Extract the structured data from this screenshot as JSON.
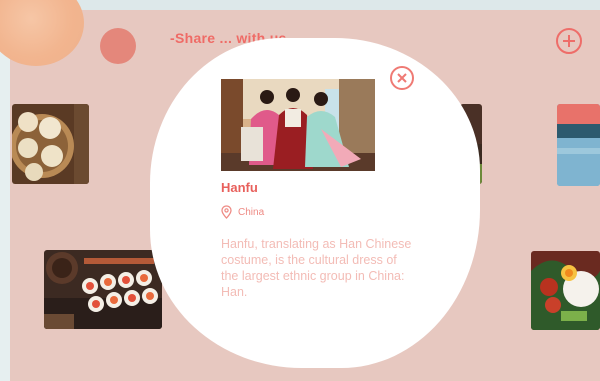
{
  "header": {
    "title": "-Share ... with us-",
    "add_icon": "plus-circle-icon"
  },
  "colors": {
    "page_background": "#e7c8c0",
    "accent": "#ef6b66",
    "modal_background": "#ffffff",
    "description_text": "#f3bcb6"
  },
  "gallery": [
    {
      "name": "dumplings",
      "icon": "food-photo"
    },
    {
      "name": "sushi",
      "icon": "food-photo"
    },
    {
      "name": "landscape",
      "icon": "scenery-photo"
    },
    {
      "name": "rice-dish",
      "icon": "food-photo"
    }
  ],
  "modal": {
    "image_icon": "hanfu-photo",
    "close_icon": "close-circle-icon",
    "title": "Hanfu",
    "location_icon": "map-pin-icon",
    "location": "China",
    "description": "Hanfu, translating as Han Chinese costume, is the cultural dress of the largest ethnic group in China: Han."
  }
}
